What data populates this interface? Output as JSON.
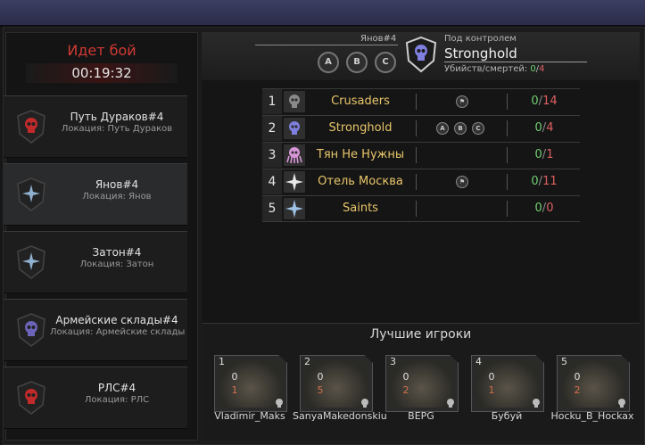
{
  "battle": {
    "status": "Идет бой",
    "timer": "00:19:32"
  },
  "locations": [
    {
      "name": "Путь Дураков#4",
      "sub": "Локация: Путь Дураков",
      "emblem": "red-skull-icon",
      "color": "#b52525"
    },
    {
      "name": "Янов#4",
      "sub": "Локация: Янов",
      "emblem": "blue-star-icon",
      "color": "#4a6a8a"
    },
    {
      "name": "Затон#4",
      "sub": "Локация: Затон",
      "emblem": "blue-star-icon",
      "color": "#4a6a8a"
    },
    {
      "name": "Армейские склады#4",
      "sub": "Локация: Армейские склады",
      "emblem": "purple-skull-icon",
      "color": "#5a4a8a"
    },
    {
      "name": "РЛС#4",
      "sub": "Локация: РЛС",
      "emblem": "red-skull-icon",
      "color": "#b52525"
    }
  ],
  "header": {
    "location": "Янов#4",
    "points": [
      "A",
      "B",
      "C"
    ],
    "control_label": "Под контролем",
    "control_name": "Stronghold",
    "kd_label": "Убийств/смертей:",
    "kills": "0",
    "deaths": "4"
  },
  "rankings": [
    {
      "rank": "1",
      "name": "Crusaders",
      "icon": "grey-skull-icon",
      "points": [
        "flag"
      ],
      "kills": "0",
      "deaths": "14"
    },
    {
      "rank": "2",
      "name": "Stronghold",
      "icon": "blue-skull-icon",
      "points": [
        "A",
        "B",
        "C"
      ],
      "kills": "0",
      "deaths": "4"
    },
    {
      "rank": "3",
      "name": "Тян Не Нужны",
      "icon": "pink-octopus-icon",
      "points": [],
      "kills": "0",
      "deaths": "1"
    },
    {
      "rank": "4",
      "name": "Отель Москва",
      "icon": "white-star-icon",
      "points": [
        "flag"
      ],
      "kills": "0",
      "deaths": "11"
    },
    {
      "rank": "5",
      "name": "Saints",
      "icon": "blue-star-icon",
      "points": [],
      "kills": "0",
      "deaths": "0"
    }
  ],
  "best": {
    "title": "Лучшие игроки",
    "players": [
      {
        "idx": "1",
        "name": "Vladimir_Maks",
        "kills": "0",
        "deaths": "1"
      },
      {
        "idx": "2",
        "name": "SanyaMakedonskiu",
        "kills": "0",
        "deaths": "5"
      },
      {
        "idx": "3",
        "name": "BEPG",
        "kills": "0",
        "deaths": "2"
      },
      {
        "idx": "4",
        "name": "Бубуй",
        "kills": "0",
        "deaths": "1"
      },
      {
        "idx": "5",
        "name": "Hocku_B_Hockax",
        "kills": "0",
        "deaths": "2"
      }
    ]
  },
  "separator": "/"
}
